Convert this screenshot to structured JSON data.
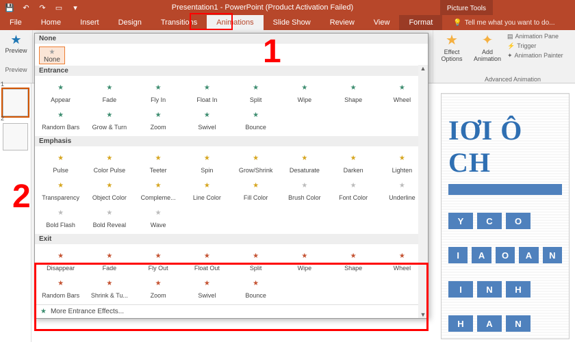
{
  "title": "Presentation1 - PowerPoint (Product Activation Failed)",
  "context_tab": "Picture Tools",
  "tabs": {
    "file": "File",
    "list": [
      "Home",
      "Insert",
      "Design",
      "Transitions",
      "Animations",
      "Slide Show",
      "Review",
      "View"
    ],
    "active": "Animations",
    "format": "Format",
    "tellme": "Tell me what you want to do..."
  },
  "preview_group": {
    "label": "Preview",
    "caption": "Preview"
  },
  "advanced": {
    "effect_options": "Effect Options",
    "add_animation": "Add Animation",
    "pane": "Animation Pane",
    "trigger": "Trigger",
    "painter": "Animation Painter",
    "group": "Advanced Animation"
  },
  "gallery": {
    "none_header": "None",
    "none_item": "None",
    "entrance": {
      "header": "Entrance",
      "items": [
        "Appear",
        "Fade",
        "Fly In",
        "Float In",
        "Split",
        "Wipe",
        "Shape",
        "Wheel",
        "Random Bars",
        "Grow & Turn",
        "Zoom",
        "Swivel",
        "Bounce"
      ]
    },
    "emphasis": {
      "header": "Emphasis",
      "items": [
        "Pulse",
        "Color Pulse",
        "Teeter",
        "Spin",
        "Grow/Shrink",
        "Desaturate",
        "Darken",
        "Lighten",
        "Transparency",
        "Object Color",
        "Compleme...",
        "Line Color",
        "Fill Color",
        "Brush Color",
        "Font Color",
        "Underline",
        "Bold Flash",
        "Bold Reveal",
        "Wave"
      ],
      "dimmed": [
        "Brush Color",
        "Font Color",
        "Underline",
        "Bold Flash",
        "Bold Reveal",
        "Wave"
      ]
    },
    "exit": {
      "header": "Exit",
      "items": [
        "Disappear",
        "Fade",
        "Fly Out",
        "Float Out",
        "Split",
        "Wipe",
        "Shape",
        "Wheel",
        "Random Bars",
        "Shrink & Tu...",
        "Zoom",
        "Swivel",
        "Bounce"
      ]
    },
    "more": "More Entrance Effects..."
  },
  "markers": {
    "one": "1",
    "two": "2"
  },
  "thumbs": {
    "n1": "1",
    "n2": "2"
  },
  "slide": {
    "title_fragment": "IƠI Ô CH",
    "rows": [
      [
        "Y",
        "C",
        "O"
      ],
      [
        "I",
        "A",
        "O",
        "A",
        "N"
      ],
      [
        "I",
        "N",
        "H"
      ],
      [
        "H",
        "A",
        "N"
      ]
    ]
  }
}
